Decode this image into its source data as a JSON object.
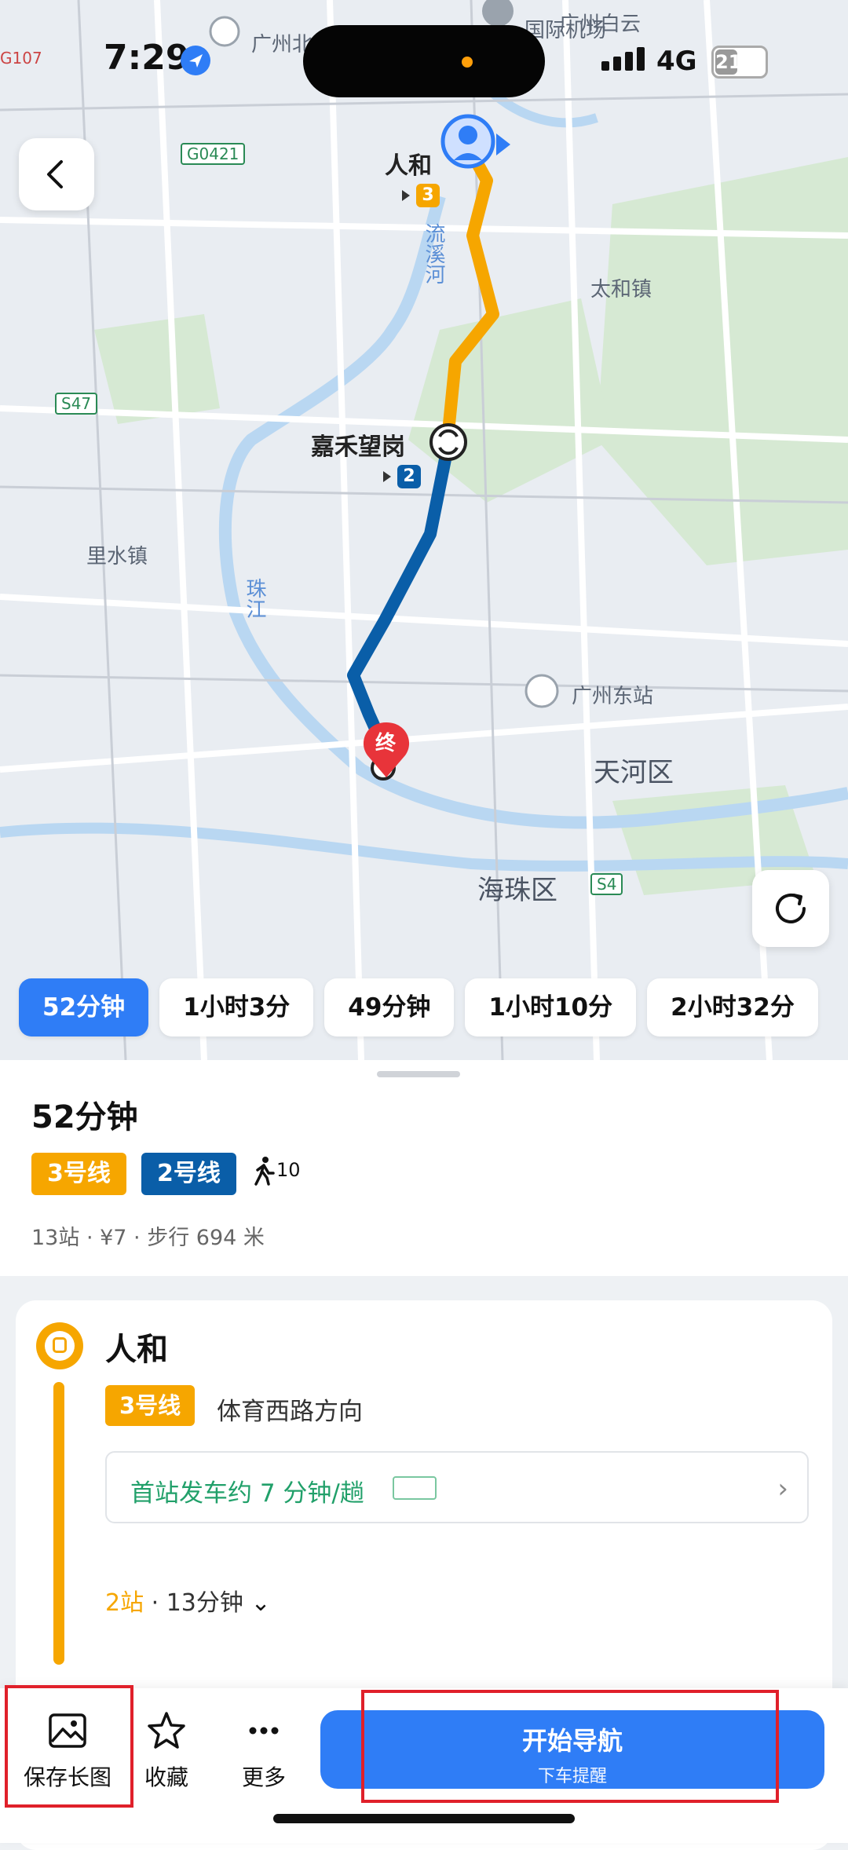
{
  "status_bar": {
    "time": "7:29",
    "network": "4G",
    "battery": "21"
  },
  "map": {
    "labels": {
      "renhe_map": "人和",
      "taihe": "太和镇",
      "liuxi": "流溪河",
      "lishui": "里水镇",
      "zhujiang": "珠江",
      "guangzhou_east": "广州东站",
      "tianhe": "天河区",
      "haizhu": "海珠区",
      "airport": "国际机场",
      "airport_top": "广州白云",
      "guangzhou_north": "广州北",
      "road_g0421": "G0421",
      "road_s47": "S47",
      "road_s4": "S4",
      "road_g107": "G107",
      "transfer_station": "嘉禾望岗",
      "end_marker": "终"
    },
    "route_badges": {
      "line3": "3",
      "line2": "2"
    },
    "colors": {
      "line3": "#f6a600",
      "line2": "#0a5ea8",
      "accent": "#2f7df6",
      "end": "#e8343a"
    }
  },
  "route_options": [
    "52分钟",
    "1小时3分",
    "49分钟",
    "1小时10分",
    "2小时32分"
  ],
  "selected_option": 0,
  "summary": {
    "duration": "52分钟",
    "line3_tag": "3号线",
    "line2_tag": "2号线",
    "walk_minutes": "10",
    "details": "13站 · ¥7 · 步行 694 米"
  },
  "detail": {
    "station": "人和",
    "line": "3号线",
    "direction": "体育西路方向",
    "first_train": "首站发车约 7 分钟/趟",
    "stops_count": "2站",
    "stops_time": " · 13分钟"
  },
  "bottom_bar": {
    "save_image": "保存长图",
    "favorite": "收藏",
    "more": "更多",
    "start_nav": "开始导航",
    "alight_reminder": "下车提醒"
  }
}
